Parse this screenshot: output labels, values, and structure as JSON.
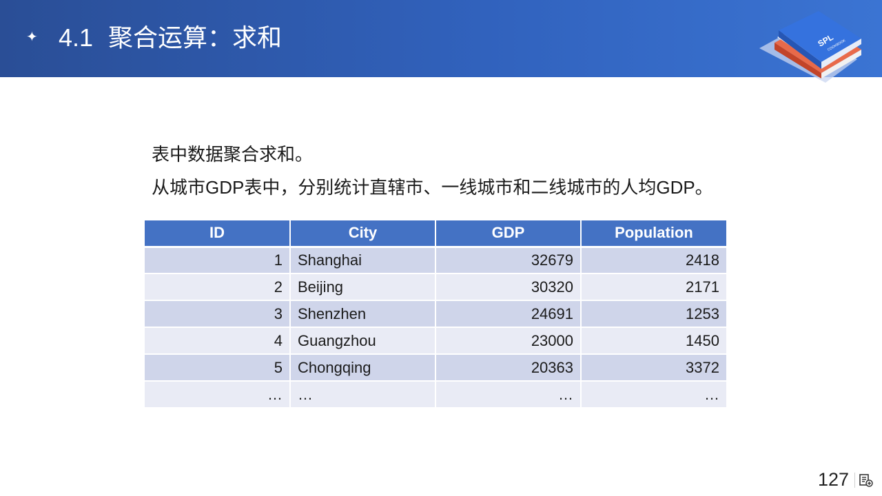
{
  "header": {
    "section_number": "4.1",
    "section_title": "聚合运算：求和",
    "bullet_icon": "sparkle-star-icon",
    "book_label": "SPL",
    "book_sublabel": "COOKBOOK"
  },
  "intro": {
    "line1": "表中数据聚合求和。",
    "line2": "从城市GDP表中，分别统计直辖市、一线城市和二线城市的人均GDP。"
  },
  "table": {
    "headers": [
      "ID",
      "City",
      "GDP",
      "Population"
    ],
    "rows": [
      [
        "1",
        "Shanghai",
        "32679",
        "2418"
      ],
      [
        "2",
        "Beijing",
        "30320",
        "2171"
      ],
      [
        "3",
        "Shenzhen",
        "24691",
        "1253"
      ],
      [
        "4",
        "Guangzhou",
        "23000",
        "1450"
      ],
      [
        "5",
        "Chongqing",
        "20363",
        "3372"
      ],
      [
        "…",
        "…",
        "…",
        "…"
      ]
    ]
  },
  "footer": {
    "page_number": "127",
    "notes_icon": "slide-notes-icon"
  },
  "colors": {
    "header_start": "#2a4e96",
    "header_end": "#3b74d3",
    "table_header": "#4472c4",
    "row_odd": "#cfd5ea",
    "row_even": "#e9ebf5",
    "book_blue": "#2f6fdc",
    "book_red": "#d7553a"
  }
}
